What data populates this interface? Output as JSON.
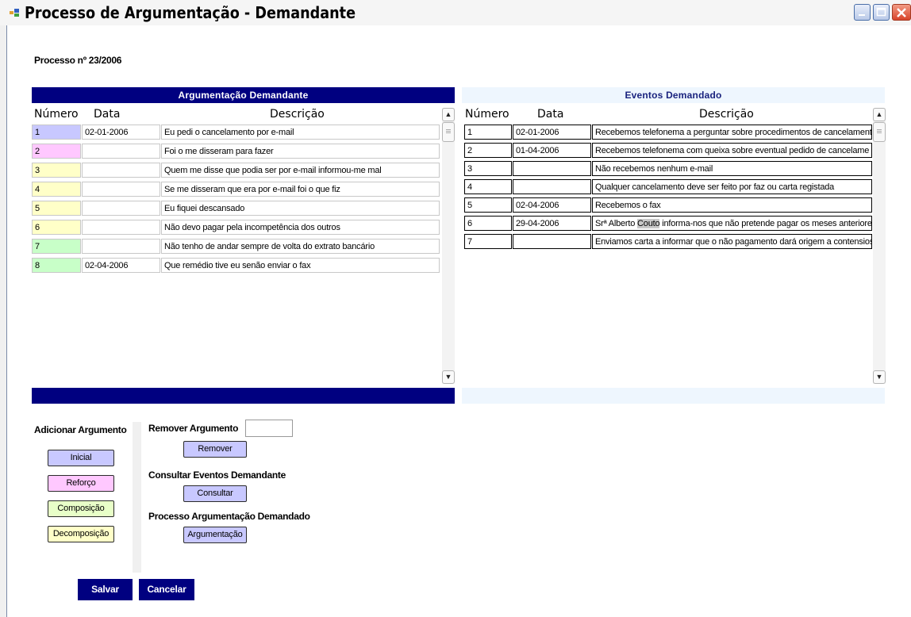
{
  "window": {
    "title": "Processo de Argumentação - Demandante"
  },
  "process_label": "Processo nº 23/2006",
  "colors": {
    "navy": "#000080",
    "light_header": "#eef6fe",
    "inicial": "#c8c8ff",
    "reforco": "#ffc8ff",
    "composicao": "#e8ffc8",
    "decomposicao": "#ffffc8",
    "row_green": "#c8ffc8"
  },
  "left_panel": {
    "title": "Argumentação Demandante",
    "columns": [
      "Número",
      "Data",
      "Descrição"
    ],
    "rows": [
      {
        "num": "1",
        "date": "02-01-2006",
        "desc": "Eu pedi o cancelamento por e-mail",
        "color": "#c8c8ff"
      },
      {
        "num": "2",
        "date": "",
        "desc": "Foi o me disseram para fazer",
        "color": "#ffc8ff"
      },
      {
        "num": "3",
        "date": "",
        "desc": "Quem me disse que podia ser por e-mail informou-me mal",
        "color": "#ffffc8"
      },
      {
        "num": "4",
        "date": "",
        "desc": "Se me disseram que era por e-mail foi o que fiz",
        "color": "#ffffc8"
      },
      {
        "num": "5",
        "date": "",
        "desc": "Eu fiquei descansado",
        "color": "#ffffc8"
      },
      {
        "num": "6",
        "date": "",
        "desc": "Não devo pagar pela incompetência dos outros",
        "color": "#ffffc8"
      },
      {
        "num": "7",
        "date": "",
        "desc": "Não tenho de andar sempre de volta do extrato bancário",
        "color": "#c8ffc8"
      },
      {
        "num": "8",
        "date": "02-04-2006",
        "desc": "Que remédio tive eu senão enviar o fax",
        "color": "#c8ffc8"
      }
    ]
  },
  "right_panel": {
    "title": "Eventos Demandado",
    "columns": [
      "Número",
      "Data",
      "Descrição"
    ],
    "rows": [
      {
        "num": "1",
        "date": "02-01-2006",
        "desc": "Recebemos telefonema a perguntar sobre procedimentos de cancelament"
      },
      {
        "num": "2",
        "date": "01-04-2006",
        "desc": "Recebemos telefonema com queixa sobre eventual pedido de cancelame"
      },
      {
        "num": "3",
        "date": "",
        "desc": "Não recebemos nenhum e-mail"
      },
      {
        "num": "4",
        "date": "",
        "desc": "Qualquer cancelamento deve ser feito por faz ou carta registada"
      },
      {
        "num": "5",
        "date": "02-04-2006",
        "desc": "Recebemos o fax"
      },
      {
        "num": "6",
        "date": "29-04-2006",
        "desc_pre": "Srª Alberto ",
        "desc_hl": "Couto",
        "desc_post": " informa-nos que não pretende pagar os meses anteriores"
      },
      {
        "num": "7",
        "date": "",
        "desc": "Enviamos carta a informar que o não pagamento dará origem a contensios"
      }
    ]
  },
  "add_section": {
    "label": "Adicionar Argumento",
    "buttons": {
      "inicial": "Inicial",
      "reforco": "Reforço",
      "composicao": "Composição",
      "decomposicao": "Decomposição"
    }
  },
  "remove_section": {
    "label": "Remover Argumento",
    "input_value": "",
    "button": "Remover"
  },
  "consult_section": {
    "label": "Consultar Eventos Demandante",
    "button": "Consultar"
  },
  "argument_section": {
    "label": "Processo Argumentação Demandado",
    "button": "Argumentação"
  },
  "footer": {
    "save": "Salvar",
    "cancel": "Cancelar"
  }
}
